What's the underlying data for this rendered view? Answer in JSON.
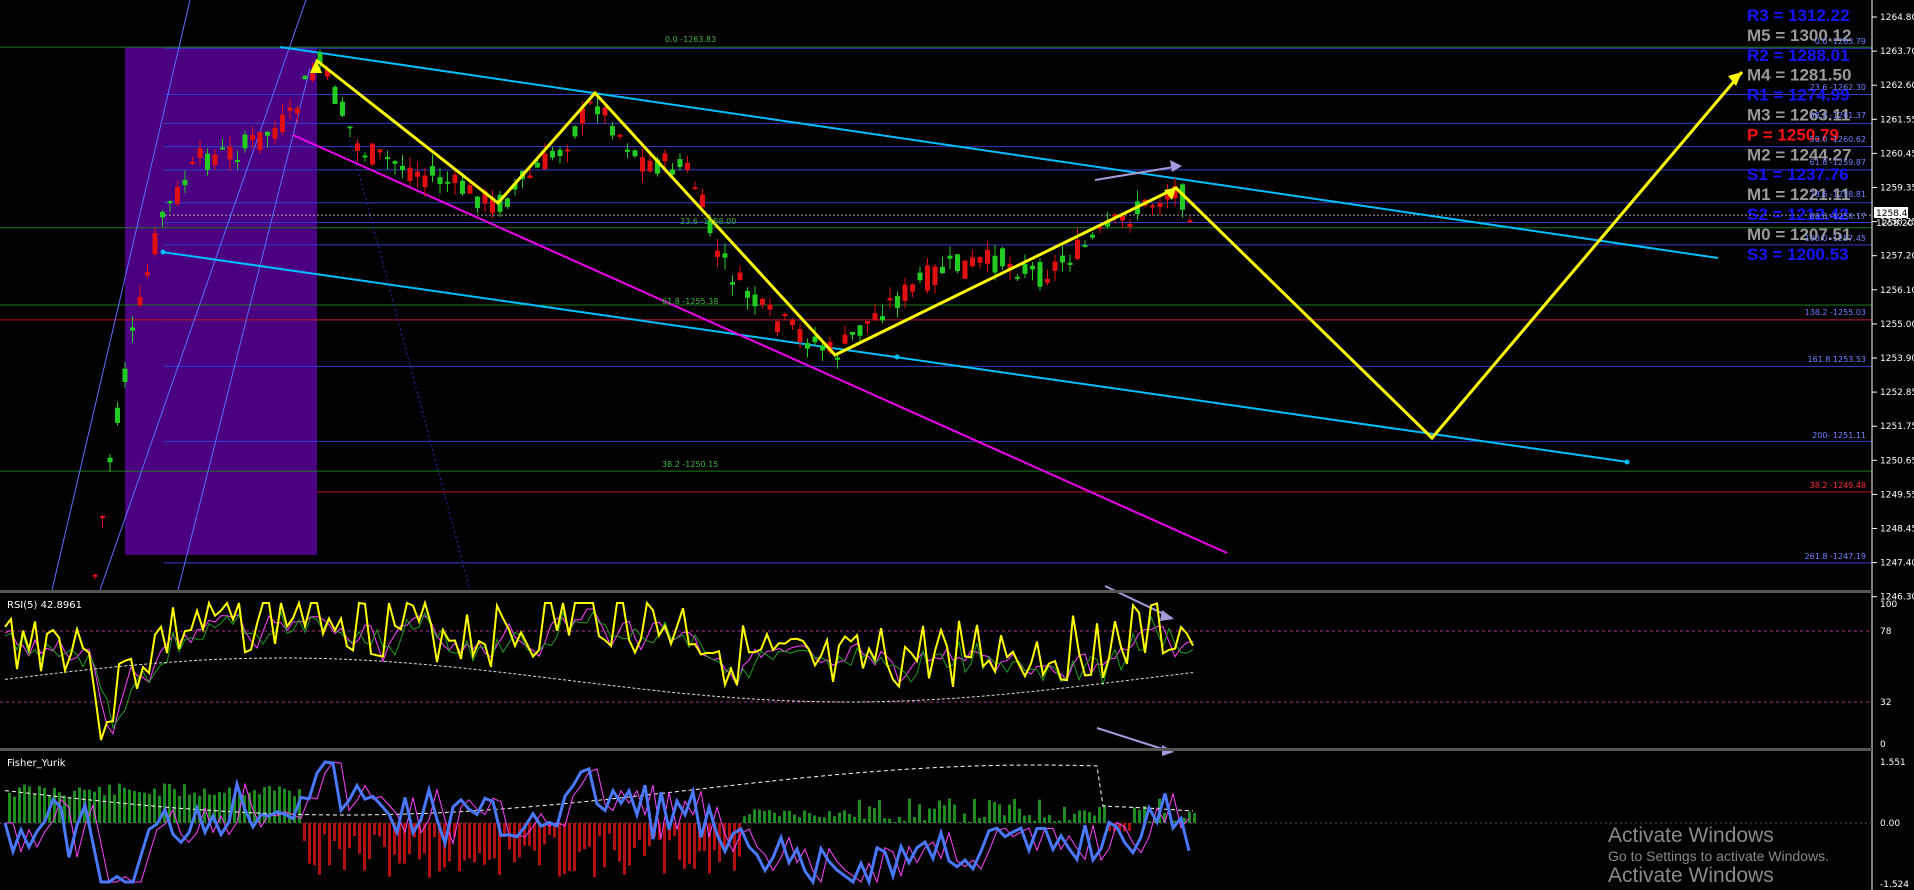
{
  "chart_data": {
    "type": "candlestick",
    "price_axis": {
      "ticks": [
        "1264.80",
        "1263.70",
        "1262.60",
        "1261.55",
        "1260.45",
        "1259.35",
        "1258.25",
        "1257.20",
        "1256.10",
        "1255.00",
        "1253.90",
        "1252.85",
        "1251.75",
        "1250.65",
        "1249.55",
        "1248.45",
        "1247.40",
        "1246.30"
      ],
      "current_price_labels": [
        "1258.41",
        "1258.20"
      ]
    },
    "pivot_levels": [
      {
        "label": "R3 = 1312.22",
        "color": "#1515ff"
      },
      {
        "label": "M5 = 1300.12",
        "color": "#9a9a9a"
      },
      {
        "label": "R2 = 1288.01",
        "color": "#1515ff"
      },
      {
        "label": "M4 = 1281.50",
        "color": "#9a9a9a"
      },
      {
        "label": "R1 = 1274.99",
        "color": "#1515ff"
      },
      {
        "label": "M3 = 1263.11",
        "color": "#9a9a9a"
      },
      {
        "label": "P  = 1250.79",
        "color": "#ff1010"
      },
      {
        "label": "M2 = 1244.27",
        "color": "#9a9a9a"
      },
      {
        "label": "S1 = 1237.76",
        "color": "#1515ff"
      },
      {
        "label": "M1 = 1221.11",
        "color": "#9a9a9a"
      },
      {
        "label": "S2 = 1212.42",
        "color": "#1515ff"
      },
      {
        "label": "M0 = 1207.51",
        "color": "#9a9a9a"
      },
      {
        "label": "S3 = 1200.53",
        "color": "#1515ff"
      }
    ],
    "fibo_right_labels": [
      {
        "text": "0.0 -1263.79",
        "color": "#6f83ff"
      },
      {
        "text": "23.6 -1262.30",
        "color": "#6f83ff"
      },
      {
        "text": "38.2 -1261.37",
        "color": "#6f83ff"
      },
      {
        "text": "50.0 -1260.62",
        "color": "#6f83ff"
      },
      {
        "text": "61.8 -1259.87",
        "color": "#6f83ff"
      },
      {
        "text": "78.6 -1258.81",
        "color": "#6f83ff"
      },
      {
        "text": "88.6 -1258.17",
        "color": "#6f83ff"
      },
      {
        "text": "100.0 -1257.45",
        "color": "#6f83ff"
      },
      {
        "text": "138.2 -1255.03",
        "color": "#6f83ff"
      },
      {
        "text": "161.8 1253.53",
        "color": "#6f83ff"
      },
      {
        "text": "200- 1251.11",
        "color": "#6f83ff"
      },
      {
        "text": "38.2 -1249.48",
        "color": "#ff3030"
      },
      {
        "text": "261.8 -1247.19",
        "color": "#6f83ff"
      }
    ],
    "fibo_mid_labels": [
      {
        "text": "0.0 -1263.83",
        "color": "#3bb33b"
      },
      {
        "text": "23.6 -1258.00",
        "color": "#3bb33b"
      },
      {
        "text": "61.8 -1255.38",
        "color": "#3bb33b"
      },
      {
        "text": "38.2 -1250.15",
        "color": "#3bb33b"
      }
    ],
    "rsi": {
      "label": "RSI(5) 42.8961",
      "levels": [
        "100",
        "78",
        "32",
        "0"
      ]
    },
    "fisher": {
      "label": "Fisher_Yurik",
      "levels": [
        "1.551",
        "0.00",
        "-1.524"
      ]
    }
  },
  "watermark": {
    "title": "Activate Windows",
    "subtitle": "Go to Settings to activate Windows."
  }
}
